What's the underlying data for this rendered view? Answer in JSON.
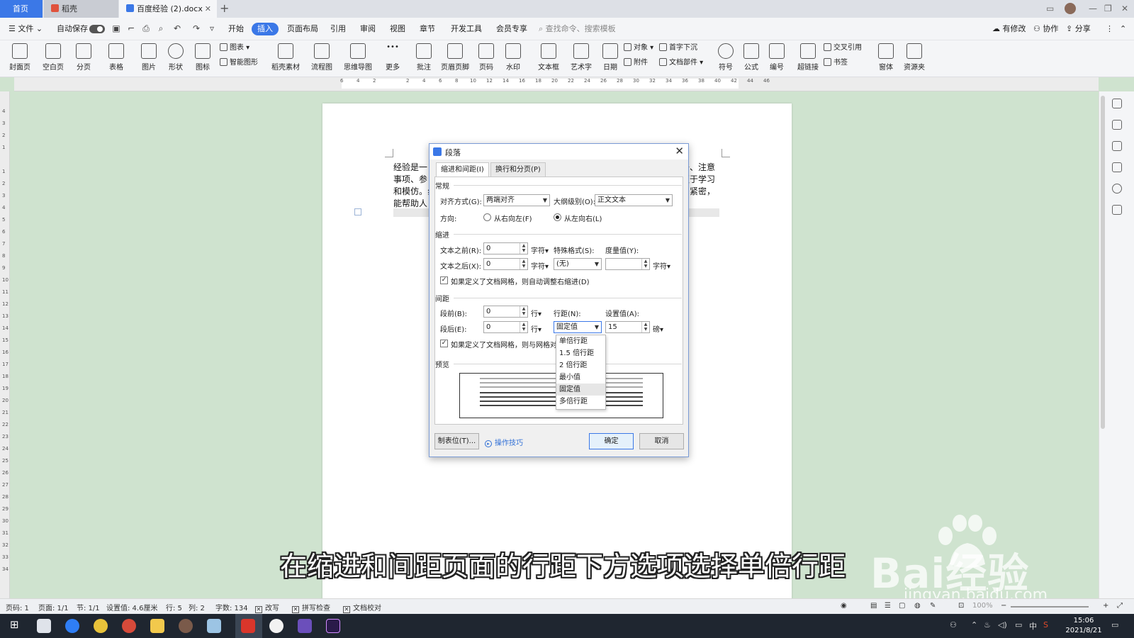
{
  "tabs": {
    "home": "首页",
    "daoke": "稻壳",
    "doc": "百度经验 (2).docx",
    "new": "+"
  },
  "menu": {
    "file": "文件",
    "autosave": "自动保存",
    "items": [
      "开始",
      "插入",
      "页面布局",
      "引用",
      "审阅",
      "视图",
      "章节",
      "开发工具",
      "会员专享"
    ],
    "search": "查找命令、搜索模板",
    "right": [
      "有修改",
      "协作",
      "分享"
    ]
  },
  "ribbon": {
    "buttons": [
      "封面页",
      "空白页",
      "分页",
      "表格",
      "图片",
      "形状",
      "图标",
      "稻壳素材",
      "流程图",
      "思维导图",
      "更多",
      "批注",
      "页眉页脚",
      "页码",
      "水印",
      "文本框",
      "艺术字",
      "日期",
      "符号",
      "公式",
      "编号",
      "超链接",
      "窗体",
      "资源夹"
    ],
    "small": [
      "图表",
      "智能图形",
      "对象",
      "附件",
      "首字下沉",
      "文档部件",
      "交叉引用",
      "书签"
    ]
  },
  "ruler": {
    "h_ticks": [
      "6",
      "4",
      "2",
      "2",
      "4",
      "6",
      "8",
      "10",
      "12",
      "14",
      "16",
      "18",
      "20",
      "22",
      "24",
      "26",
      "28",
      "30",
      "32",
      "34",
      "36",
      "38",
      "40",
      "42",
      "44",
      "46"
    ],
    "v_ticks": [
      "4",
      "3",
      "2",
      "1",
      "1",
      "2",
      "3",
      "4",
      "5",
      "6",
      "7",
      "8",
      "9",
      "10",
      "11",
      "12",
      "13",
      "14",
      "15",
      "16",
      "17",
      "18",
      "19",
      "20",
      "21",
      "22",
      "23",
      "24",
      "25",
      "26",
      "27",
      "28",
      "29",
      "30",
      "31",
      "32",
      "33",
      "34"
    ]
  },
  "document": {
    "lines": [
      {
        "left": "经验是一",
        "right": "去、注意"
      },
      {
        "left": "事项、参",
        "right": "更于学习"
      },
      {
        "left": "和模仿。纟",
        "right": "系紧密，"
      },
      {
        "left": "能帮助人",
        "right": ""
      }
    ]
  },
  "dialog": {
    "title": "段落",
    "tab_indent": "缩进和间距(I)",
    "tab_break": "换行和分页(P)",
    "sec_general": "常规",
    "align_label": "对齐方式(G):",
    "align_value": "两端对齐",
    "outline_label": "大纲级别(O):",
    "outline_value": "正文文本",
    "direction_label": "方向:",
    "rtl": "从右向左(F)",
    "ltr": "从左向右(L)",
    "sec_indent": "缩进",
    "before_text_label": "文本之前(R):",
    "before_text_value": "0",
    "after_text_label": "文本之后(X):",
    "after_text_value": "0",
    "unit_char": "字符",
    "special_label": "特殊格式(S):",
    "special_value": "(无)",
    "measure_label": "度量值(Y):",
    "measure_value": "",
    "auto_indent": "如果定义了文档网格，则自动调整右缩进(D)",
    "sec_spacing": "间距",
    "before_label": "段前(B):",
    "before_value": "0",
    "after_label": "段后(E):",
    "after_value": "0",
    "unit_line": "行",
    "linespacing_label": "行距(N):",
    "linespacing_value": "固定值",
    "setvalue_label": "设置值(A):",
    "setvalue_value": "15",
    "unit_pt": "磅",
    "snap_grid": "如果定义了文档网格，则与网格对",
    "preview_label": "预览",
    "tabs_button": "制表位(T)...",
    "tips": "操作技巧",
    "ok": "确定",
    "cancel": "取消"
  },
  "dropdown": {
    "options": [
      "单倍行距",
      "1.5 倍行距",
      "2 倍行距",
      "最小值",
      "固定值",
      "多倍行距"
    ],
    "selected": "固定值"
  },
  "subtitle": "在缩进和间距页面的行距下方选项选择单倍行距",
  "watermark": {
    "brand": "Bai经验",
    "url": "jingyan.baidu.com"
  },
  "status": {
    "page_num": "页码: 1",
    "pages": "页面: 1/1",
    "section": "节: 1/1",
    "setvalue": "设置值: 4.6厘米",
    "row": "行: 5",
    "col": "列: 2",
    "words": "字数: 134",
    "overwrite": "改写",
    "spellcheck": "拼写检查",
    "doccheck": "文档校对",
    "zoom": "100%"
  },
  "clock": {
    "time": "15:06",
    "date": "2021/8/21"
  },
  "tray": {
    "lang": "中"
  },
  "colors": {
    "accent": "#3b78e7",
    "workspace": "#cfe3cf",
    "taskbar": "#1f2630"
  }
}
